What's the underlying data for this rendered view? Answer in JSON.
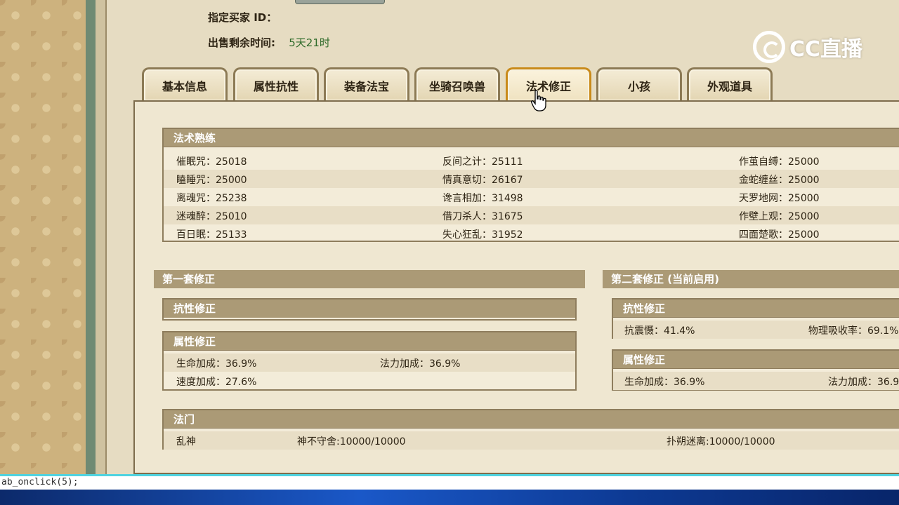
{
  "header": {
    "buyer_id_label": "指定买家 ID：",
    "buyer_id_value": "",
    "remaining_label": "出售剩余时间:",
    "remaining_value": "5天21时"
  },
  "logo": {
    "text": "CC直播",
    "icon": "cc-logo-icon"
  },
  "tabs": [
    {
      "label": "基本信息"
    },
    {
      "label": "属性抗性"
    },
    {
      "label": "装备法宝"
    },
    {
      "label": "坐骑召唤兽"
    },
    {
      "label": "法术修正",
      "active": true
    },
    {
      "label": "小孩"
    },
    {
      "label": "外观道具"
    }
  ],
  "spell_mastery": {
    "title": "法术熟练",
    "rows": [
      [
        "催眠咒：25018",
        "反间之计：25111",
        "作茧自缚：25000"
      ],
      [
        "瞌睡咒：25000",
        "情真意切：26167",
        "金蛇缠丝：25000"
      ],
      [
        "离魂咒：25238",
        "谗言相加：31498",
        "天罗地网：25000"
      ],
      [
        "迷魂醉：25010",
        "借刀杀人：31675",
        "作壁上观：25000"
      ],
      [
        "百日眠：25133",
        "失心狂乱：31952",
        "四面楚歌：25000"
      ]
    ]
  },
  "set1": {
    "title": "第一套修正",
    "resist_title": "抗性修正",
    "attr_title": "属性修正",
    "attr_rows": [
      [
        "生命加成：36.9%",
        "法力加成：36.9%"
      ],
      [
        "速度加成：27.6%",
        ""
      ]
    ]
  },
  "set2": {
    "title": "第二套修正 (当前启用)",
    "resist_title": "抗性修正",
    "resist_rows": [
      [
        "抗震慑：41.4%",
        "物理吸收率：69.1%"
      ]
    ],
    "attr_title": "属性修正",
    "attr_rows": [
      [
        "生命加成：36.9%",
        "法力加成：36.9%"
      ]
    ]
  },
  "school": {
    "title": "法门",
    "items": [
      "乱神",
      "神不守舍:10000/10000",
      "扑朔迷离:10000/10000"
    ]
  },
  "status_bar": {
    "text": "ab_onclick(5);"
  }
}
